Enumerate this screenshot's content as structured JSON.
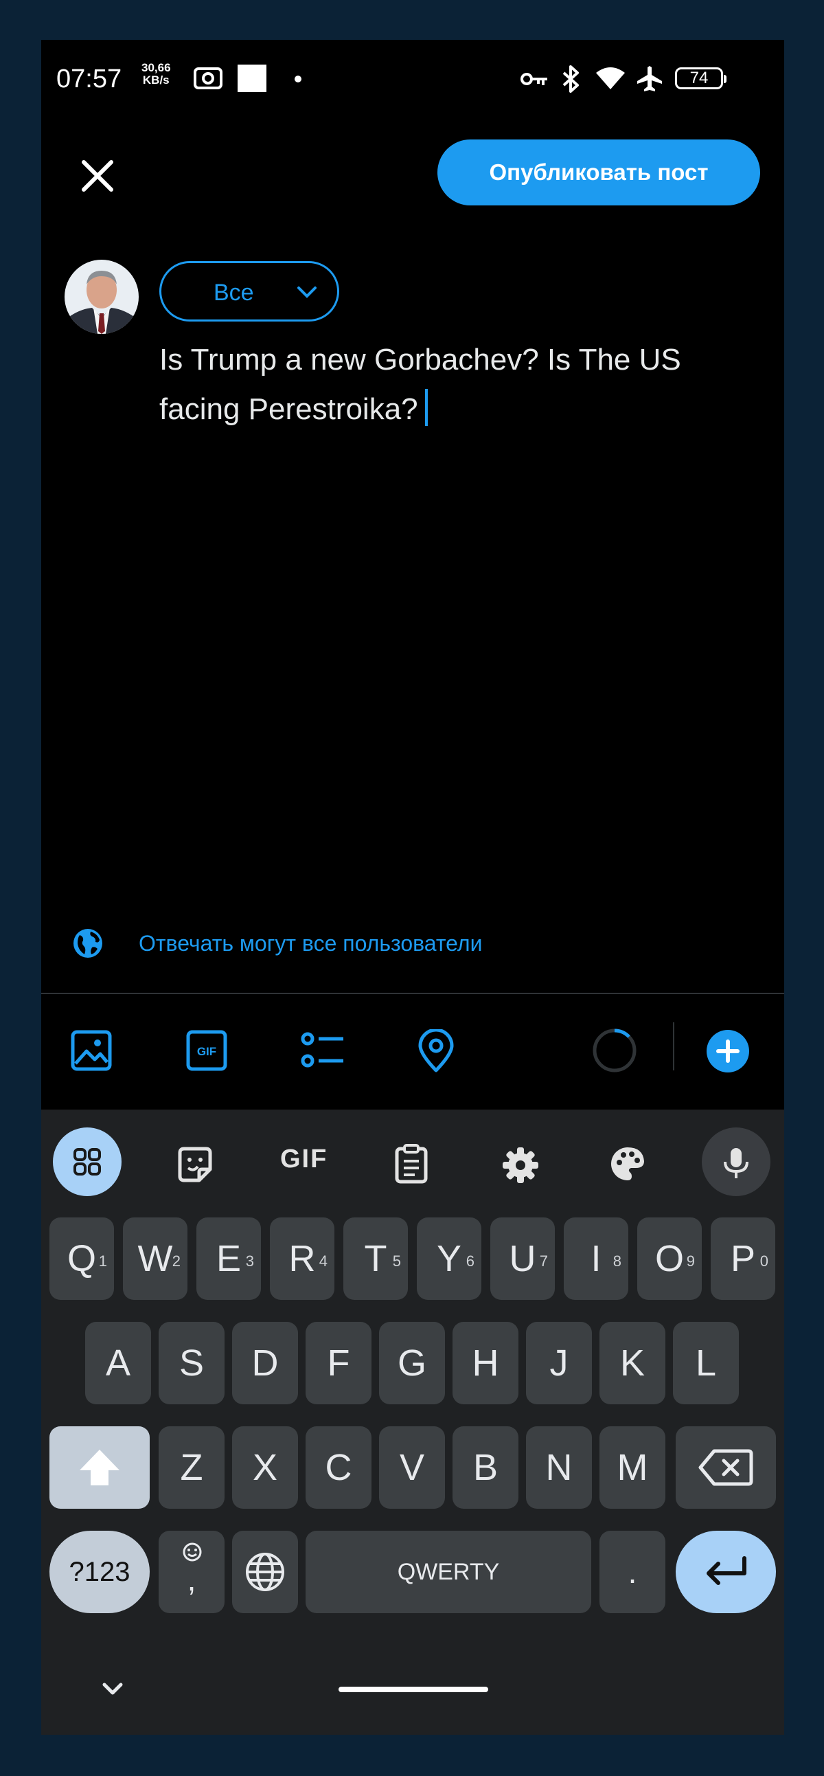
{
  "status_bar": {
    "time": "07:57",
    "speed_value": "30,66",
    "speed_unit": "KB/s",
    "battery": "74"
  },
  "header": {
    "publish_label": "Опубликовать пост"
  },
  "compose": {
    "audience_label": "Все",
    "post_text": "Is Trump a new Gorbachev? Is The US facing Perestroika?"
  },
  "reply_setting": {
    "label": "Отвечать могут все пользователи"
  },
  "toolbar": {
    "icons": [
      "image-icon",
      "gif-icon",
      "poll-icon",
      "location-icon",
      "character-counter-icon",
      "add-post-icon"
    ]
  },
  "keyboard": {
    "toolbar": {
      "gif_label": "GIF",
      "icons": [
        "apps-grid-icon",
        "sticker-icon",
        "gif-icon",
        "clipboard-icon",
        "settings-icon",
        "theme-palette-icon",
        "microphone-icon"
      ]
    },
    "row1": [
      {
        "label": "Q",
        "hint": "1"
      },
      {
        "label": "W",
        "hint": "2"
      },
      {
        "label": "E",
        "hint": "3"
      },
      {
        "label": "R",
        "hint": "4"
      },
      {
        "label": "T",
        "hint": "5"
      },
      {
        "label": "Y",
        "hint": "6"
      },
      {
        "label": "U",
        "hint": "7"
      },
      {
        "label": "I",
        "hint": "8"
      },
      {
        "label": "O",
        "hint": "9"
      },
      {
        "label": "P",
        "hint": "0"
      }
    ],
    "row2": [
      "A",
      "S",
      "D",
      "F",
      "G",
      "H",
      "J",
      "K",
      "L"
    ],
    "row3": [
      "Z",
      "X",
      "C",
      "V",
      "B",
      "N",
      "M"
    ],
    "symbols_label": "?123",
    "comma_label": ",",
    "space_label": "QWERTY",
    "period_label": "."
  },
  "colors": {
    "accent": "#1d9bf0",
    "background": "#000000",
    "frame": "#0b2236",
    "keyboard_bg": "#1f2123",
    "key_bg": "#3c4043",
    "key_accent": "#a8d1f7"
  }
}
